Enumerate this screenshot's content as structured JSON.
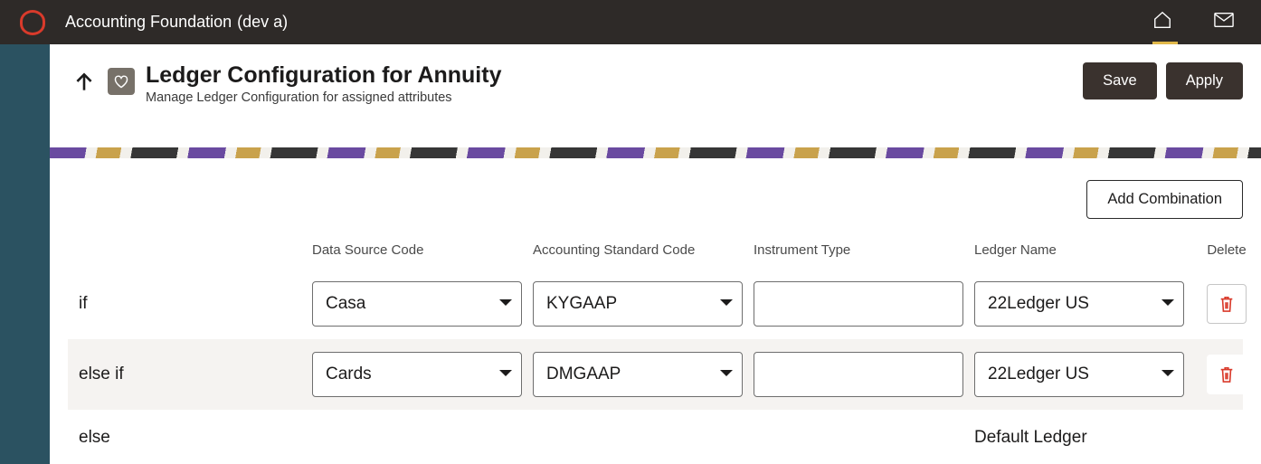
{
  "topbar": {
    "app_title": "Accounting Foundation",
    "env_tag": "(dev a)"
  },
  "header": {
    "page_title": "Ledger Configuration for Annuity",
    "page_subtitle": "Manage Ledger Configuration for assigned attributes",
    "save_label": "Save",
    "apply_label": "Apply"
  },
  "content": {
    "add_combination_label": "Add Combination",
    "columns": {
      "data_source_code": "Data Source Code",
      "accounting_standard_code": "Accounting Standard Code",
      "instrument_type": "Instrument Type",
      "ledger_name": "Ledger Name",
      "delete": "Delete"
    },
    "rows": [
      {
        "condition": "if",
        "data_source_code": "Casa",
        "accounting_standard_code": "KYGAAP",
        "instrument_type": "",
        "ledger_name": "22Ledger US"
      },
      {
        "condition": "else if",
        "data_source_code": "Cards",
        "accounting_standard_code": "DMGAAP",
        "instrument_type": "",
        "ledger_name": "22Ledger US"
      }
    ],
    "default": {
      "condition": "else",
      "ledger_name": "Default Ledger"
    }
  }
}
